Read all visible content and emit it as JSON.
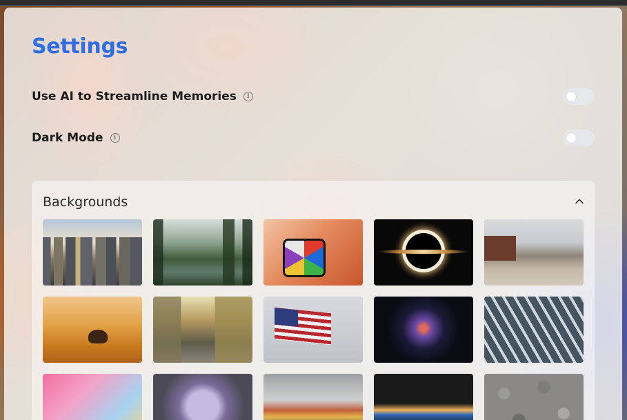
{
  "page": {
    "title": "Settings"
  },
  "settings": [
    {
      "label": "Use AI to Streamline Memories",
      "info_icon": "info-icon",
      "enabled": false
    },
    {
      "label": "Dark Mode",
      "info_icon": "info-icon",
      "enabled": false
    }
  ],
  "backgrounds": {
    "title": "Backgrounds",
    "collapse_icon": "chevron-up-icon",
    "thumbnails": [
      {
        "subject": "city skyline"
      },
      {
        "subject": "forest river"
      },
      {
        "subject": "megaminx puzzle in hands"
      },
      {
        "subject": "black hole"
      },
      {
        "subject": "coastal cabin"
      },
      {
        "subject": "desert camel"
      },
      {
        "subject": "narrow street"
      },
      {
        "subject": "american flag on columns"
      },
      {
        "subject": "nebula"
      },
      {
        "subject": "glass facade"
      },
      {
        "subject": "pastel gradient"
      },
      {
        "subject": "brain illustration"
      },
      {
        "subject": "harbor buildings"
      },
      {
        "subject": "horizon at dusk"
      },
      {
        "subject": "pebbles"
      }
    ]
  }
}
